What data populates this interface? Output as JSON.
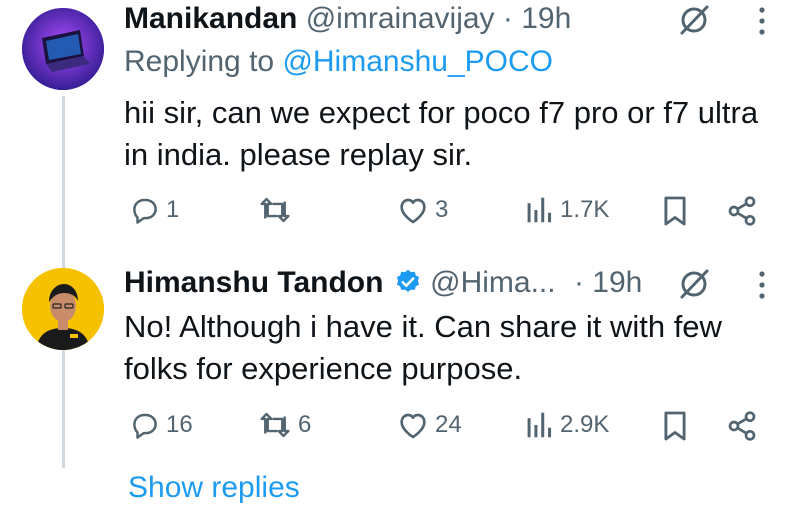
{
  "tweets": [
    {
      "name": "Manikandan",
      "handle": "@imrainavijay",
      "dot": "·",
      "time": "19h",
      "replying_label": "Replying to",
      "replying_to": "@Himanshu_POCO",
      "text": "hii sir, can we expect for poco f7 pro or f7 ultra in india. please replay sir.",
      "replies": "1",
      "retweets": "",
      "likes": "3",
      "views": "1.7K"
    },
    {
      "name": "Himanshu Tandon",
      "handle": "@Hima...",
      "dot": "·",
      "time": "19h",
      "text": "No! Although i have it. Can share it with few folks for experience purpose.",
      "replies": "16",
      "retweets": "6",
      "likes": "24",
      "views": "2.9K"
    }
  ],
  "show_replies": "Show replies",
  "colors": {
    "accent": "#1d9bf0",
    "muted": "#536471",
    "text": "#0f1419",
    "verified": "#1d9bf0"
  }
}
